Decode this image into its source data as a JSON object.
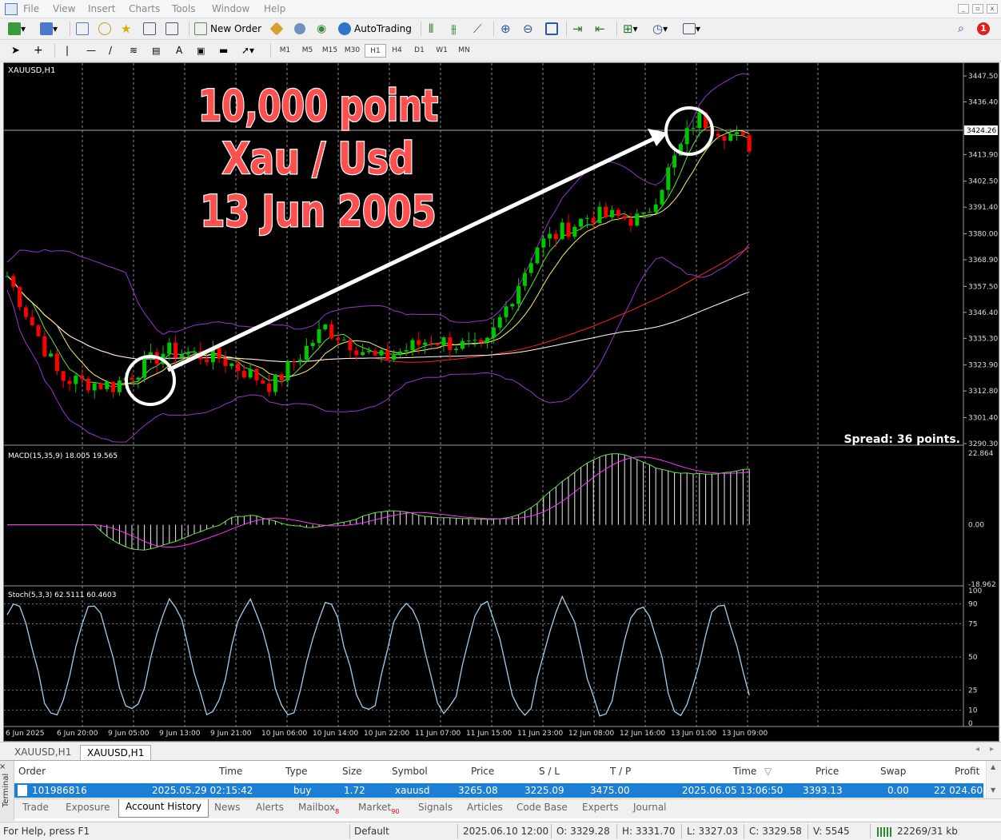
{
  "menu": [
    "File",
    "View",
    "Insert",
    "Charts",
    "Tools",
    "Window",
    "Help"
  ],
  "toolbar": {
    "new_order": "New Order",
    "autotrading": "AutoTrading",
    "notification_count": "1"
  },
  "timeframes": [
    "M1",
    "M5",
    "M15",
    "M30",
    "H1",
    "H4",
    "D1",
    "W1",
    "MN"
  ],
  "active_timeframe": "H1",
  "chart": {
    "symbol_label": "XAUUSD,H1",
    "headline": [
      "10,000 point",
      "Xau / Usd",
      "13 Jun 2005"
    ],
    "spread": "Spread: 36 points.",
    "current_price": "3424.26",
    "price_ticks": [
      "3447.50",
      "3436.40",
      "3413.90",
      "3402.50",
      "3391.40",
      "3380.00",
      "3368.90",
      "3357.50",
      "3346.40",
      "3335.30",
      "3323.90",
      "3312.80",
      "3301.40",
      "3290.30"
    ],
    "time_ticks": [
      "6 Jun 2025",
      "6 Jun 20:00",
      "9 Jun 05:00",
      "9 Jun 13:00",
      "9 Jun 21:00",
      "10 Jun 06:00",
      "10 Jun 14:00",
      "10 Jun 22:00",
      "11 Jun 07:00",
      "11 Jun 15:00",
      "11 Jun 23:00",
      "12 Jun 08:00",
      "12 Jun 16:00",
      "13 Jun 01:00",
      "13 Jun 09:00"
    ],
    "macd_label": "MACD(15,35,9) 18.005 19.565",
    "macd_ticks": [
      "22.864",
      "0.00",
      "-18.962"
    ],
    "stoch_label": "Stoch(5,3,3) 62.5111 60.4603",
    "stoch_ticks": [
      "100",
      "90",
      "75",
      "50",
      "25",
      "10",
      "0"
    ]
  },
  "chart_tabs": [
    "XAUUSD,H1",
    "XAUUSD,H1"
  ],
  "terminal": {
    "side_label": "Terminal",
    "columns": [
      "Order",
      "Time",
      "Type",
      "Size",
      "Symbol",
      "Price",
      "S / L",
      "T / P",
      "Time",
      "Price",
      "Swap",
      "Profit"
    ],
    "row": {
      "order": "101986816",
      "open_time": "2025.05.29 02:15:42",
      "type": "buy",
      "size": "1.72",
      "symbol": "xauusd",
      "price": "3265.08",
      "sl": "3225.09",
      "tp": "3475.00",
      "close_time": "2025.06.05 13:06:50",
      "close_price": "3393.13",
      "swap": "0.00",
      "profit": "22 024.60"
    },
    "tabs": [
      "Trade",
      "Exposure",
      "Account History",
      "News",
      "Alerts",
      "Mailbox",
      "Market",
      "Signals",
      "Articles",
      "Code Base",
      "Experts",
      "Journal"
    ],
    "mailbox_badge": "8",
    "market_badge": "90"
  },
  "status": {
    "help": "For Help, press F1",
    "profile": "Default",
    "datetime": "2025.06.10 12:00",
    "open": "O: 3329.28",
    "high": "H: 3331.70",
    "low": "L: 3327.03",
    "close": "C: 3329.58",
    "volume": "V: 5545",
    "traffic": "22269/31 kb"
  },
  "colors": {
    "bull": "#00c800",
    "bear": "#ff0000",
    "ma_slow": "#ff2020",
    "ma_long": "#ffffff",
    "bands": "#9933cc",
    "macd_signal": "#ff33ff",
    "stoch": "#9ad0f0",
    "selection": "#1c7fd6"
  },
  "chart_data": {
    "type": "candlestick",
    "x": [
      "6 Jun 2025",
      "6 Jun 20:00",
      "9 Jun 05:00",
      "9 Jun 13:00",
      "9 Jun 21:00",
      "10 Jun 06:00",
      "10 Jun 14:00",
      "10 Jun 22:00",
      "11 Jun 07:00",
      "11 Jun 15:00",
      "11 Jun 23:00",
      "12 Jun 08:00",
      "12 Jun 16:00",
      "13 Jun 01:00",
      "13 Jun 09:00"
    ],
    "close": [
      3362,
      3318,
      3315,
      3330,
      3327,
      3315,
      3340,
      3326,
      3335,
      3330,
      3375,
      3388,
      3386,
      3430,
      3418
    ],
    "ylim": [
      3290.3,
      3447.5
    ],
    "macd_ylim": [
      -18.962,
      22.864
    ],
    "stoch_ylim": [
      0,
      100
    ]
  }
}
